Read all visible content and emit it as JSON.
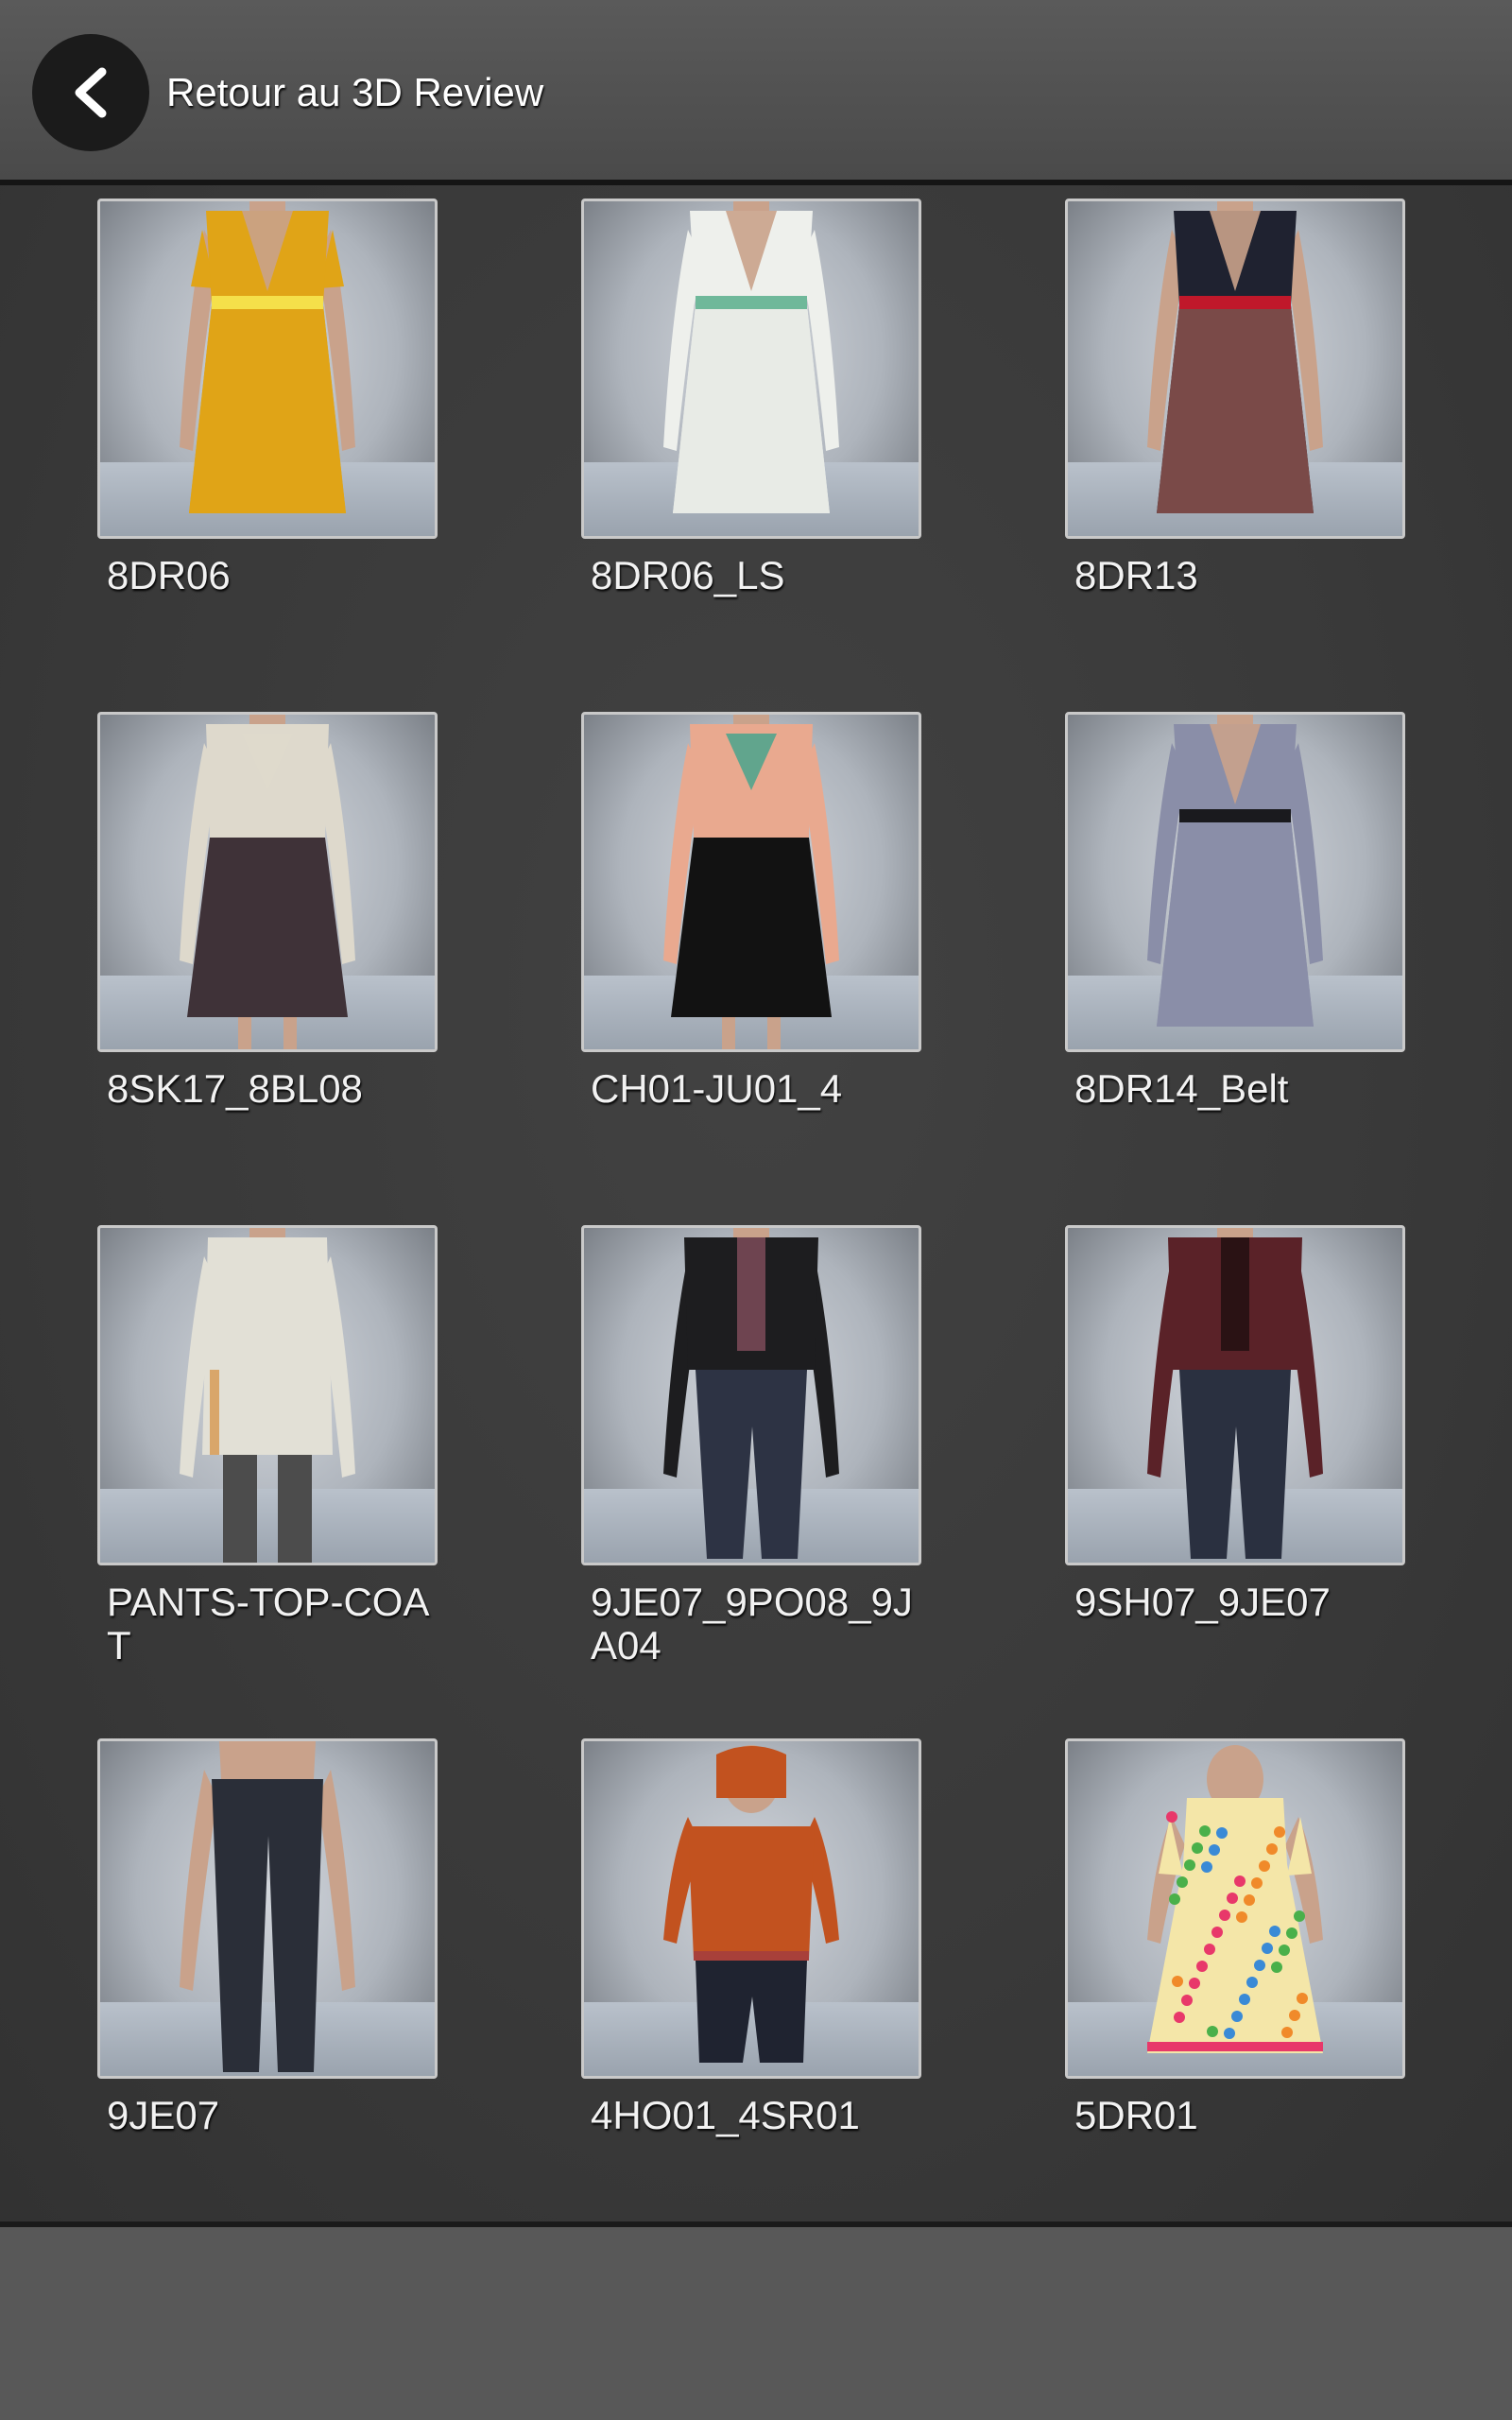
{
  "header": {
    "back_label": "Retour au 3D Review"
  },
  "colors": {
    "header_bg": "#505050",
    "grid_bg": "#3d3d3d",
    "footer_bg": "#585858",
    "text": "#f2f2f2"
  },
  "items": [
    {
      "label": "8DR06",
      "garment": "dress",
      "top": "#e0a417",
      "bottom": "#e0a417",
      "accent": "#f5e04a",
      "sleeves": "short"
    },
    {
      "label": "8DR06_LS",
      "garment": "dress",
      "top": "#eef0ec",
      "bottom": "#e8ebe6",
      "accent": "#6fb89a",
      "sleeves": "mid"
    },
    {
      "label": "8DR13",
      "garment": "dress",
      "top": "#1f2230",
      "bottom": "#7a4a48",
      "accent": "#c0182a",
      "sleeves": "none"
    },
    {
      "label": "8SK17_8BL08",
      "garment": "blouse-skirt",
      "top": "#ded9cc",
      "bottom": "#3f3238",
      "accent": "#ded9cc",
      "sleeves": "long"
    },
    {
      "label": "CH01-JU01_4",
      "garment": "blouse-skirt",
      "top": "#e9a98f",
      "bottom": "#121212",
      "accent": "#3fa48c",
      "sleeves": "long"
    },
    {
      "label": "8DR14_Belt",
      "garment": "dress",
      "top": "#8a8ea8",
      "bottom": "#8a8ea8",
      "accent": "#1a1a1e",
      "sleeves": "long"
    },
    {
      "label": "PANTS-TOP-COAT",
      "garment": "coat",
      "top": "#e2e0d6",
      "bottom": "#4c4c4c",
      "accent": "#d9a66a",
      "sleeves": "long"
    },
    {
      "label": "9JE07_9PO08_9JA04",
      "garment": "jacket-pants",
      "top": "#1d1d1f",
      "bottom": "#2d3344",
      "accent": "#6e4450",
      "sleeves": "long"
    },
    {
      "label": "9SH07_9JE07",
      "garment": "jacket-pants",
      "top": "#5a2228",
      "bottom": "#2a3040",
      "accent": "#2a1214",
      "sleeves": "long"
    },
    {
      "label": "9JE07",
      "garment": "pants",
      "top": "#c79a85",
      "bottom": "#2a2e38",
      "accent": "#2a2e38",
      "sleeves": "none"
    },
    {
      "label": "4HO01_4SR01",
      "garment": "hoodie-child",
      "top": "#c2521f",
      "bottom": "#1f2330",
      "accent": "#a8403a",
      "sleeves": "long"
    },
    {
      "label": "5DR01",
      "garment": "child-dress",
      "top": "#f4e6a8",
      "bottom": "#f4e6a8",
      "accent": "#e8386a",
      "sleeves": "short"
    }
  ]
}
